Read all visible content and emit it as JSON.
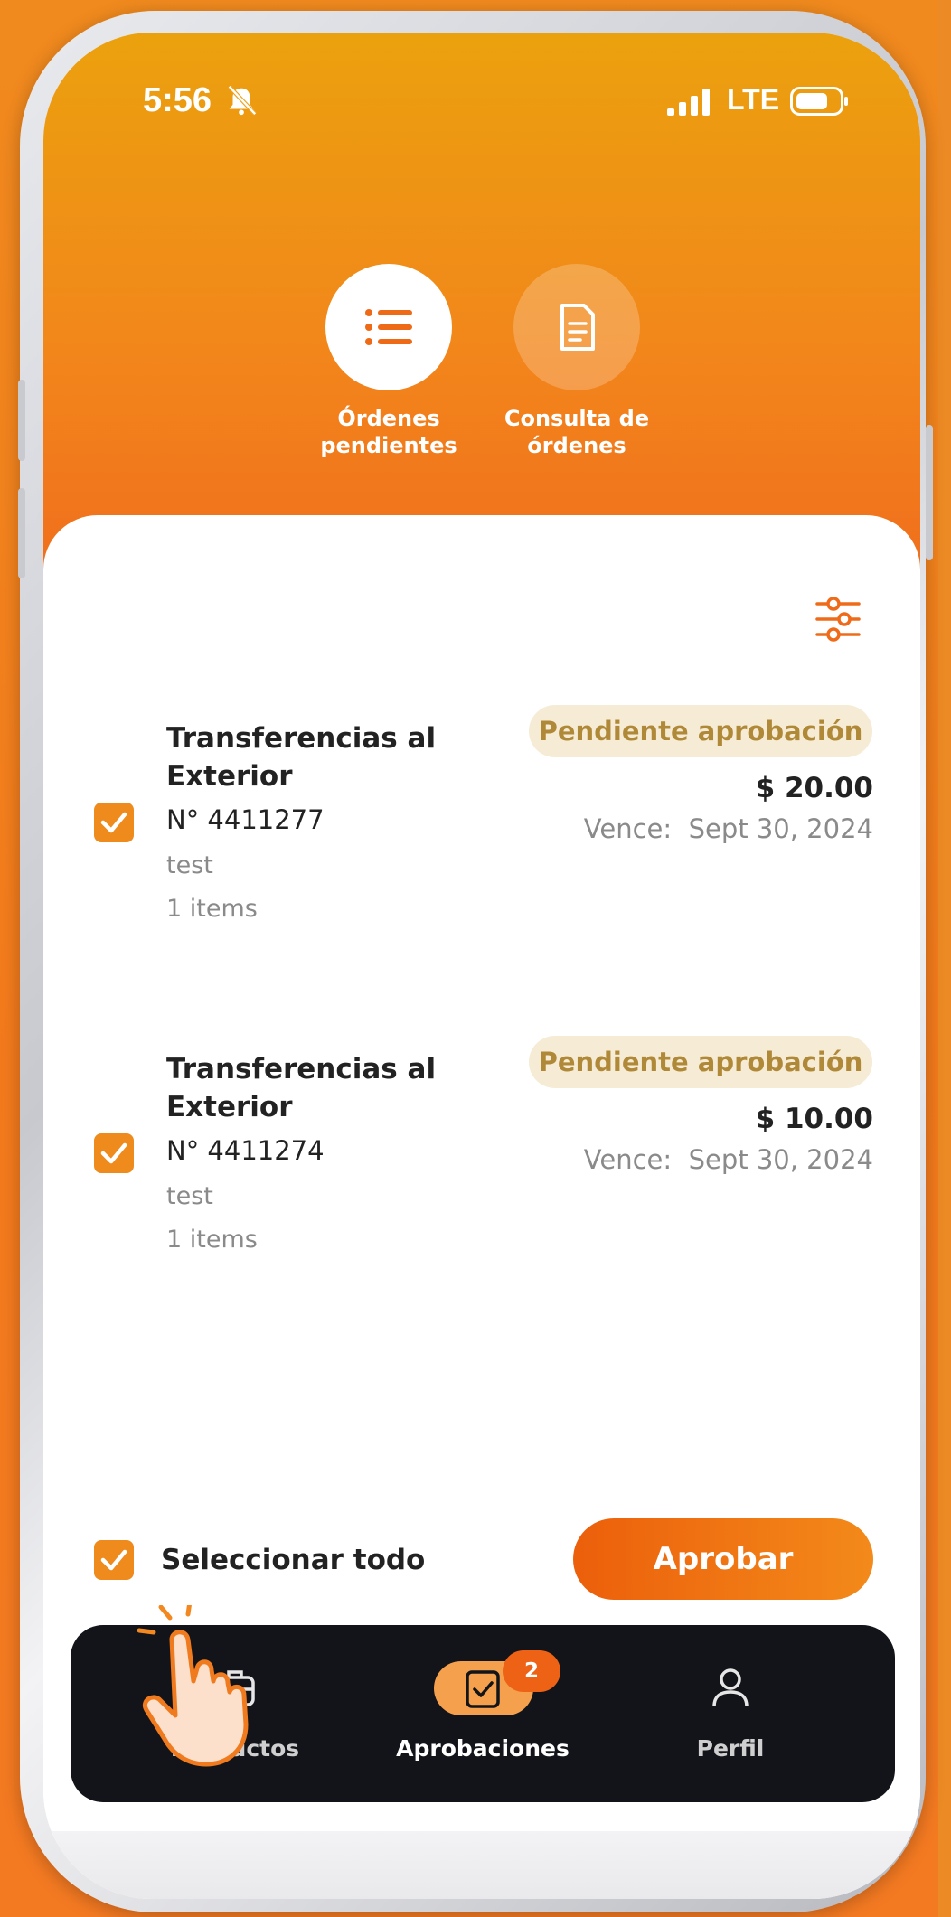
{
  "status_bar": {
    "time": "5:56",
    "network": "LTE"
  },
  "modes": [
    {
      "label_line1": "Órdenes",
      "label_line2": "pendientes",
      "active": true
    },
    {
      "label_line1": "Consulta de",
      "label_line2": "órdenes",
      "active": false
    }
  ],
  "orders": [
    {
      "title_line1": "Transferencias al",
      "title_line2": "Exterior",
      "number": "N° 4411277",
      "description": "test",
      "items": "1 items",
      "status": "Pendiente aprobación",
      "amount": "$ 20.00",
      "due": "Vence:  Sept 30, 2024",
      "checked": true
    },
    {
      "title_line1": "Transferencias al",
      "title_line2": "Exterior",
      "number": "N° 4411274",
      "description": "test",
      "items": "1 items",
      "status": "Pendiente aprobación",
      "amount": "$ 10.00",
      "due": "Vence:  Sept 30, 2024",
      "checked": true
    }
  ],
  "footer": {
    "select_all_label": "Seleccionar todo",
    "select_all_checked": true,
    "approve_label": "Aprobar"
  },
  "nav": [
    {
      "label": "Productos",
      "icon": "briefcase-icon"
    },
    {
      "label": "Aprobaciones",
      "icon": "clipboard-check-icon",
      "badge": "2",
      "active": true
    },
    {
      "label": "Perfil",
      "icon": "user-icon"
    }
  ],
  "colors": {
    "accent": "#ef8a1c",
    "approve_button": "#ec5f0b",
    "badge_bg": "#f6ecd5",
    "badge_text": "#b08938",
    "navbar": "#121419"
  }
}
